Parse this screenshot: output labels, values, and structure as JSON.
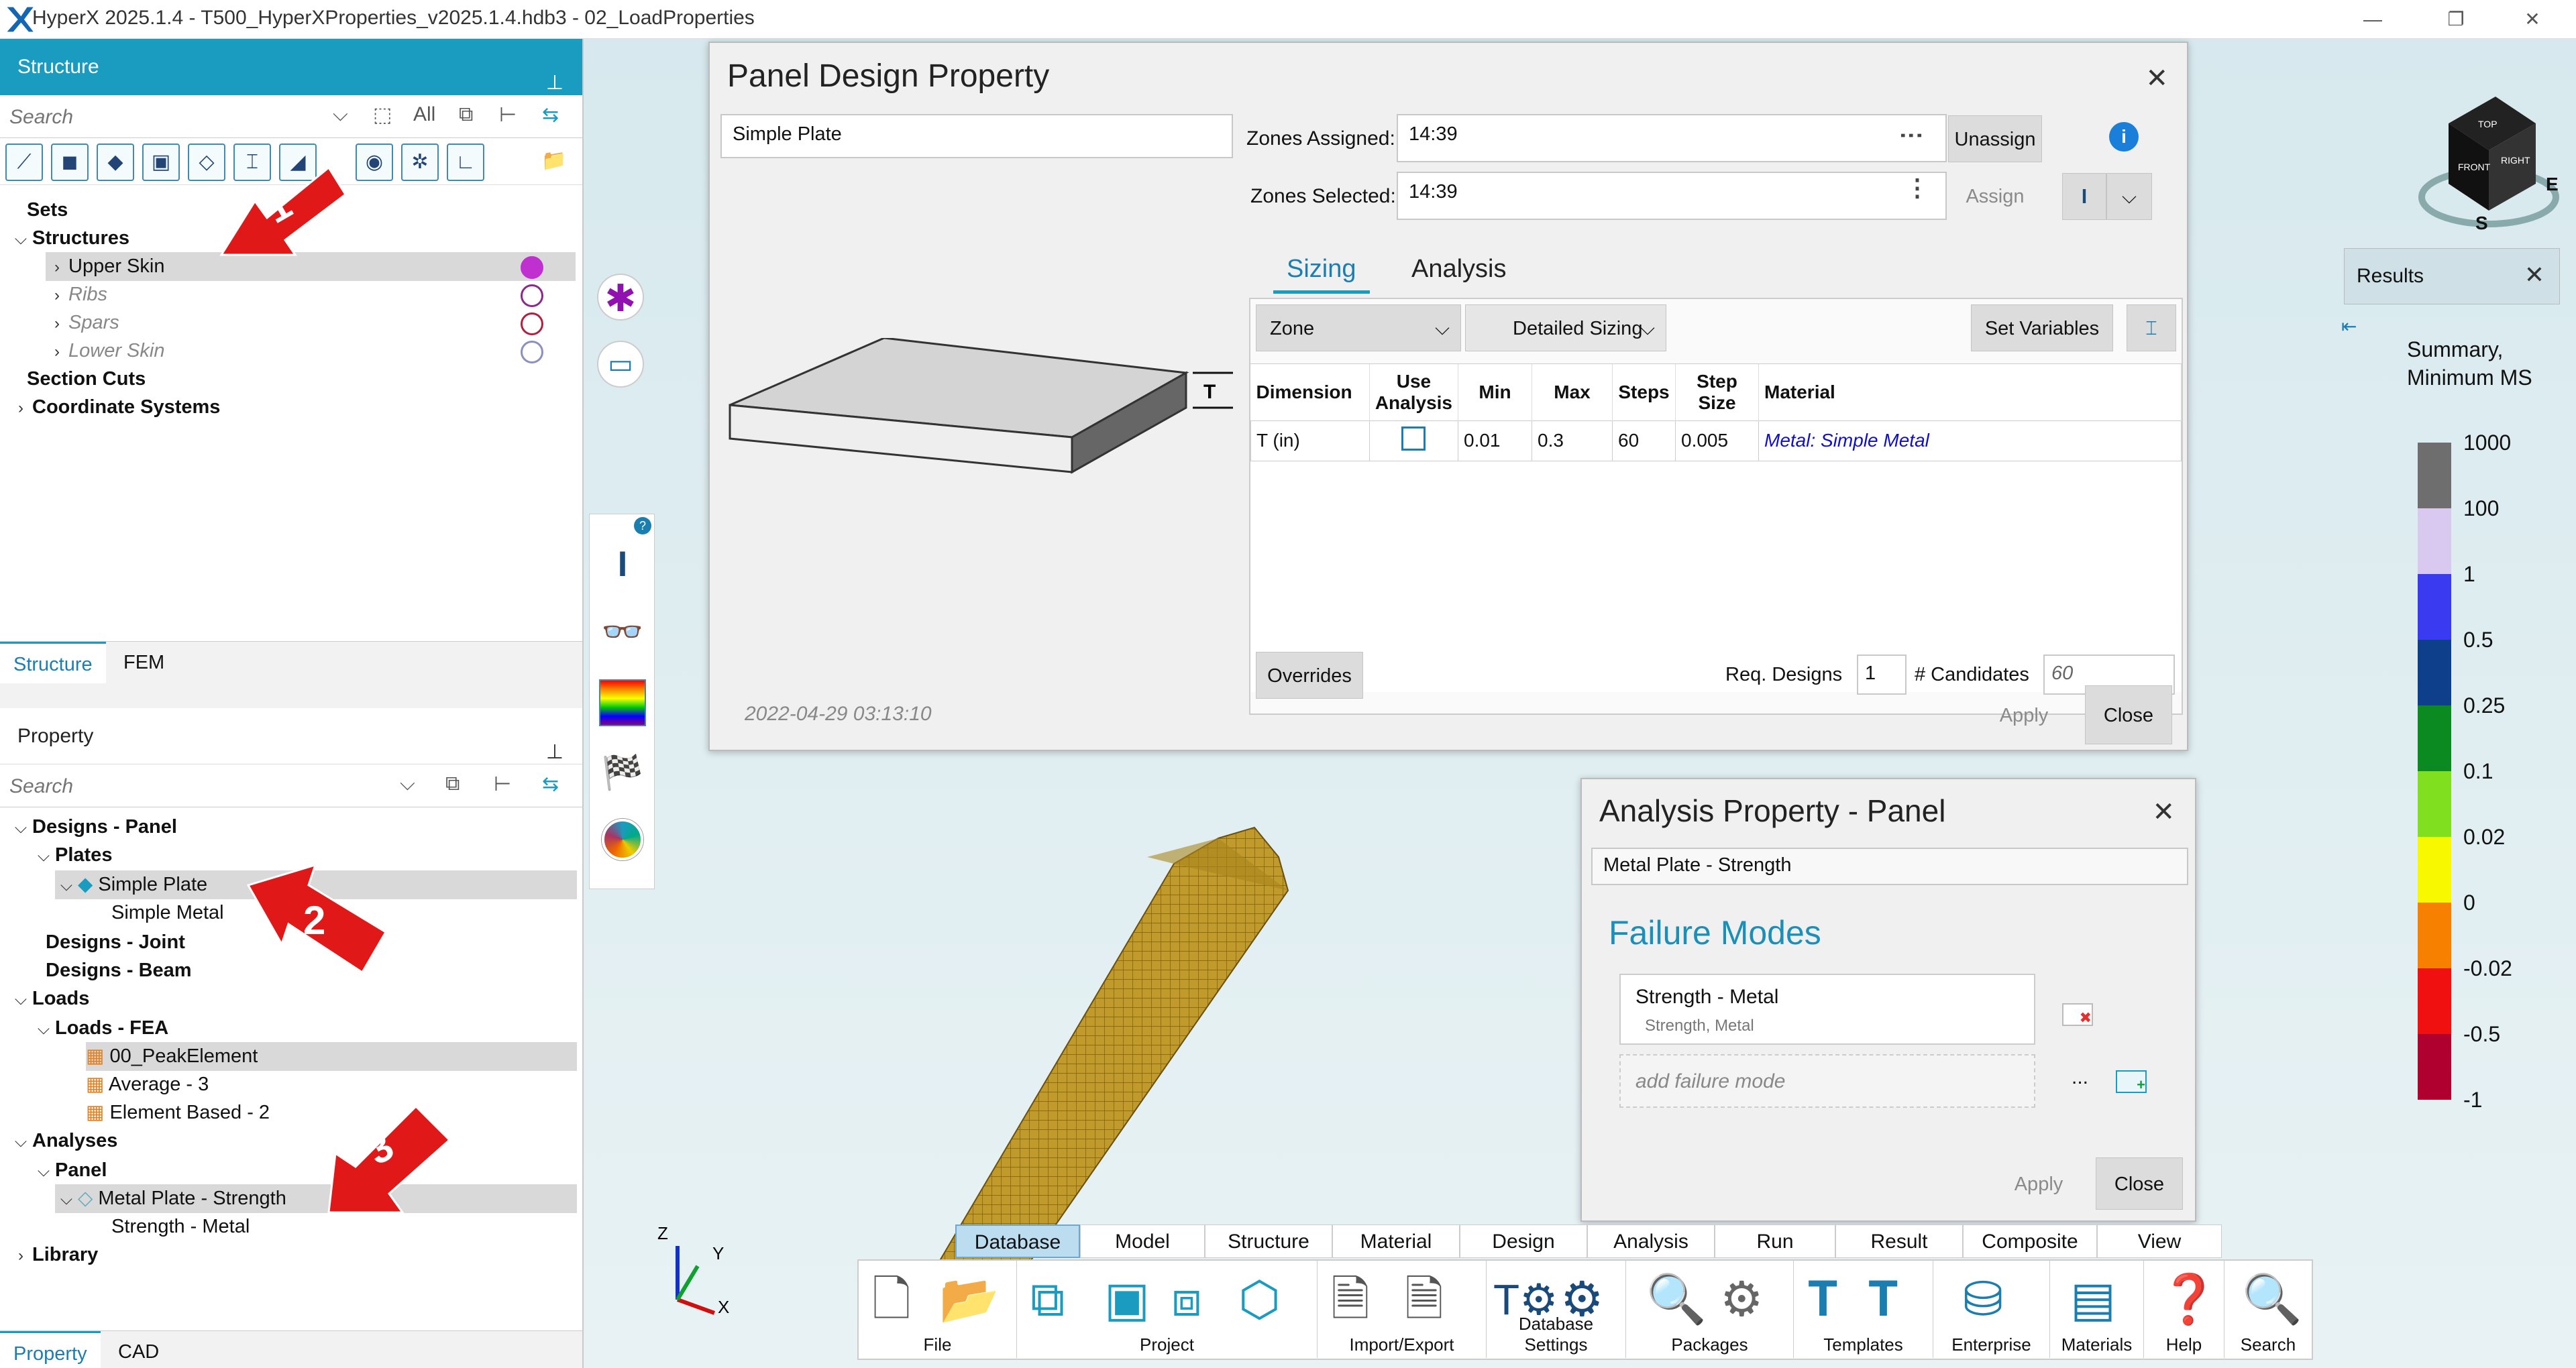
{
  "window": {
    "title": "HyperX 2025.1.4 - T500_HyperXProperties_v2025.1.4.hdb3 - 02_LoadProperties",
    "minimize": "—",
    "maximize": "❐",
    "close": "✕"
  },
  "structure_panel": {
    "title": "Structure",
    "pin": "⊥",
    "search_placeholder": "Search",
    "filter_all": "All",
    "tree": {
      "sets": "Sets",
      "structures": "Structures",
      "upper_skin": "Upper Skin",
      "ribs": "Ribs",
      "spars": "Spars",
      "lower_skin": "Lower Skin",
      "section_cuts": "Section Cuts",
      "coordinate_systems": "Coordinate Systems"
    },
    "tabs": [
      "Structure",
      "FEM"
    ],
    "colors": {
      "upper_skin": "#c030d0",
      "ribs": "#8a2a8a",
      "spars": "#b02040",
      "lower_skin": "#8a90c0"
    }
  },
  "property_panel": {
    "title": "Property",
    "pin": "⊥",
    "search_placeholder": "Search",
    "tree": {
      "designs_panel": "Designs - Panel",
      "plates": "Plates",
      "simple_plate": "Simple Plate",
      "simple_metal": "Simple Metal",
      "designs_joint": "Designs - Joint",
      "designs_beam": "Designs - Beam",
      "loads": "Loads",
      "loads_fea": "Loads - FEA",
      "peak_element": "00_PeakElement",
      "average": "Average - 3",
      "element_based": "Element Based - 2",
      "analyses": "Analyses",
      "panel": "Panel",
      "metal_plate_strength": "Metal Plate - Strength",
      "strength_metal": "Strength - Metal",
      "library": "Library"
    },
    "tabs": [
      "Property",
      "CAD"
    ]
  },
  "callouts": [
    "1",
    "2",
    "3"
  ],
  "panel_design_dialog": {
    "title": "Panel Design Property",
    "close": "✕",
    "name": "Simple Plate",
    "zones_assigned_label": "Zones Assigned:",
    "zones_assigned_value": "14:39",
    "zones_selected_label": "Zones Selected:",
    "zones_selected_value": "14:39",
    "unassign": "Unassign",
    "assign": "Assign",
    "info": "i",
    "tabs": [
      "Sizing",
      "Analysis"
    ],
    "zone_select": "Zone",
    "sizing_select": "Detailed Sizing",
    "set_variables": "Set Variables",
    "headers": [
      "Dimension",
      "Use Analysis",
      "Min",
      "Max",
      "Steps",
      "Step Size",
      "Material"
    ],
    "row": {
      "dimension": "T (in)",
      "min": "0.01",
      "max": "0.3",
      "steps": "60",
      "step_size": "0.005",
      "material": "Metal: Simple Metal"
    },
    "overrides": "Overrides",
    "req_designs_label": "Req. Designs",
    "req_designs_value": "1",
    "candidates_label": "# Candidates",
    "candidates_value": "60",
    "timestamp": "2022-04-29 03:13:10",
    "apply": "Apply",
    "close_btn": "Close",
    "thickness_label": "T"
  },
  "analysis_dialog": {
    "title": "Analysis Property - Panel",
    "close": "✕",
    "name": "Metal Plate - Strength",
    "failure_modes_title": "Failure Modes",
    "mode_name": "Strength - Metal",
    "mode_sub": "Strength, Metal",
    "add_placeholder": "add failure mode",
    "ellipsis": "...",
    "apply": "Apply",
    "close_btn": "Close"
  },
  "results_panel": {
    "title": "Results",
    "close": "✕",
    "summary_label": "Summary, Minimum MS",
    "legend": [
      {
        "label": "1000",
        "color": "#6e6e6e"
      },
      {
        "label": "100",
        "color": "#d9c8f0"
      },
      {
        "label": "1",
        "color": "#3a3af0"
      },
      {
        "label": "0.5",
        "color": "#0e3f8a"
      },
      {
        "label": "0.25",
        "color": "#0a8a20"
      },
      {
        "label": "0.1",
        "color": "#80e020"
      },
      {
        "label": "0.02",
        "color": "#f8f800"
      },
      {
        "label": "0",
        "color": "#f88000"
      },
      {
        "label": "-0.02",
        "color": "#f01010"
      },
      {
        "label": "-0.5",
        "color": "#b00030"
      },
      {
        "label": "-1",
        "color": "#700040"
      }
    ]
  },
  "viewcube": {
    "top": "TOP",
    "front": "FRONT",
    "right": "RIGHT",
    "e": "E",
    "s": "S"
  },
  "axes": {
    "x": "X",
    "y": "Y",
    "z": "Z"
  },
  "ribbon": {
    "tabs": [
      "Database",
      "Model",
      "Structure",
      "Material",
      "Design",
      "Analysis",
      "Run",
      "Result",
      "Composite",
      "View"
    ],
    "groups": [
      "File",
      "Project",
      "Import/Export",
      "Database Settings",
      "Packages",
      "Templates",
      "Enterprise",
      "Materials",
      "Help",
      "Search"
    ]
  }
}
